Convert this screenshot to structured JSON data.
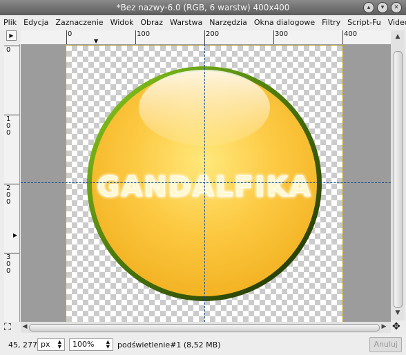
{
  "window": {
    "title": "*Bez nazwy-6.0 (RGB, 6 warstw) 400x400",
    "buttons": [
      "▴",
      "▾",
      "✕"
    ]
  },
  "menu": [
    "Plik",
    "Edycja",
    "Zaznaczenie",
    "Widok",
    "Obraz",
    "Warstwa",
    "Narzędzia",
    "Okna dialogowe",
    "Filtry",
    "Script-Fu",
    "Video"
  ],
  "rulers": {
    "horizontal": [
      "0",
      "100",
      "200",
      "300",
      "400"
    ],
    "vertical": [
      "0",
      "100",
      "200",
      "300"
    ]
  },
  "canvas": {
    "logo_text": "GANDALFIKA",
    "colors": {
      "checker_light": "#ffffff",
      "checker_dark": "#cbcbcb",
      "orb_center": "#ffe87c",
      "orb_edge": "#f3b324",
      "rim_light": "#8fd41e",
      "rim_dark": "#1c2d04",
      "guide": "#1e4f8c"
    }
  },
  "statusbar": {
    "coords": "45, 277",
    "unit": "px",
    "zoom": "100%",
    "message": "podświetlenie#1 (8,52 MB)",
    "cancel": "Anuluj"
  },
  "icons": {
    "quick_mask": "quick-mask-icon",
    "navigate": "navigate-icon",
    "menu_arrow": "menu-arrow-icon"
  }
}
